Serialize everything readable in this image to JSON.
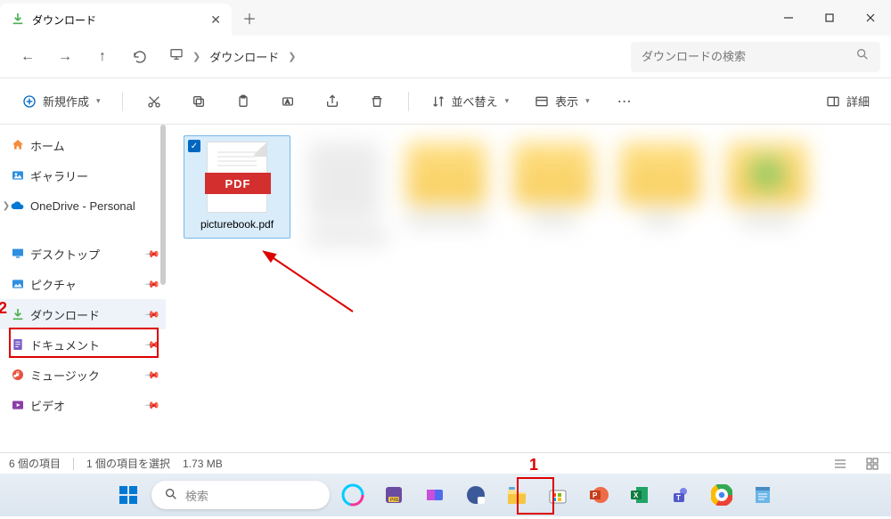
{
  "tab": {
    "title": "ダウンロード"
  },
  "breadcrumb": {
    "current": "ダウンロード"
  },
  "search": {
    "placeholder": "ダウンロードの検索"
  },
  "toolbar": {
    "new_label": "新規作成",
    "sort_label": "並べ替え",
    "view_label": "表示",
    "detail_label": "詳細"
  },
  "sidebar": {
    "home": "ホーム",
    "gallery": "ギャラリー",
    "onedrive": "OneDrive - Personal",
    "desktop": "デスクトップ",
    "pictures": "ピクチャ",
    "downloads": "ダウンロード",
    "documents": "ドキュメント",
    "music": "ミュージック",
    "videos": "ビデオ"
  },
  "file": {
    "name": "picturebook.pdf",
    "badge": "PDF"
  },
  "status": {
    "count": "6 個の項目",
    "selected": "1 個の項目を選択",
    "size": "1.73 MB"
  },
  "taskbar_search": "検索",
  "annotations": {
    "n1": "1",
    "n2": "2"
  }
}
